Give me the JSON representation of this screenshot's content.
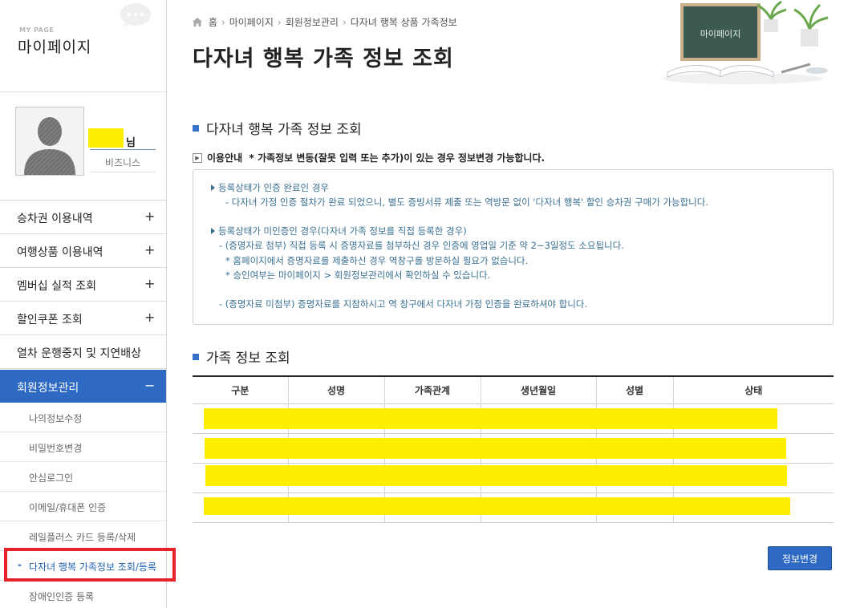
{
  "sidebar": {
    "mypage_small": "MY PAGE",
    "mypage_title": "마이페이지",
    "user_suffix": "님",
    "user_grade": "비즈니스",
    "menu": [
      {
        "label": "승차권 이용내역",
        "sign": "+"
      },
      {
        "label": "여행상품 이용내역",
        "sign": "+"
      },
      {
        "label": "멤버십 실적 조회",
        "sign": "+"
      },
      {
        "label": "할인쿠폰 조회",
        "sign": "+"
      },
      {
        "label": "열차 운행중지 및 지연배상",
        "sign": ""
      },
      {
        "label": "회원정보관리",
        "sign": "−"
      }
    ],
    "submenu": [
      {
        "label": "나의정보수정"
      },
      {
        "label": "비밀번호변경"
      },
      {
        "label": "안심로그인"
      },
      {
        "label": "이메일/휴대폰 인증"
      },
      {
        "label": "레일플러스 카드 등록/삭제"
      },
      {
        "label": "다자녀 행복 가족정보 조회/등록",
        "dash": "-"
      },
      {
        "label": "장애인인증 등록"
      }
    ]
  },
  "breadcrumb": [
    "홈",
    "마이페이지",
    "회원정보관리",
    "다자녀 행복 상품 가족정보"
  ],
  "page_title": "다자녀 행복 가족 정보 조회",
  "deco_board_text": "마이페이지",
  "section1": {
    "title": "다자녀 행복 가족 정보 조회",
    "info_label": "이용안내",
    "info_note": "* 가족정보 변동(잘못 입력 또는 추가)이 있는 경우 정보변경 가능합니다.",
    "lines": [
      "등록상태가 인증 완료인 경우",
      "- 다자녀 가정 인증 절차가 완료 되었으니, 별도 증빙서류 제출 또는 역방문 없이 '다자녀 행복' 할인 승차권 구매가 가능합니다.",
      "등록상태가 미인증인 경우(다자녀 가족 정보를 직접 등록한 경우)",
      "- (증명자료 첨부) 직접 등록 시 증명자료를 첨부하신 경우 인증에 영업일 기준 약 2~3일정도 소요됩니다.",
      "* 홈페이지에서 증명자료를 제출하신 경우 역창구를 방문하실 필요가 없습니다.",
      "* 승인여부는 마이페이지 > 회원정보관리에서 확인하실 수 있습니다.",
      "- (증명자료 미첨부) 증명자료를 지참하시고 역 창구에서 다자녀 가정 인증을 완료하셔야 합니다."
    ]
  },
  "section2": {
    "title": "가족 정보 조회",
    "columns": [
      "구분",
      "성명",
      "가족관계",
      "생년월일",
      "성별",
      "상태"
    ],
    "row_count": 4
  },
  "edit_button": "정보변경",
  "colors": {
    "accent": "#2e69c4",
    "highlight": "#ffee00",
    "info_text": "#3a6f92",
    "selection_box": "#e8202a"
  }
}
